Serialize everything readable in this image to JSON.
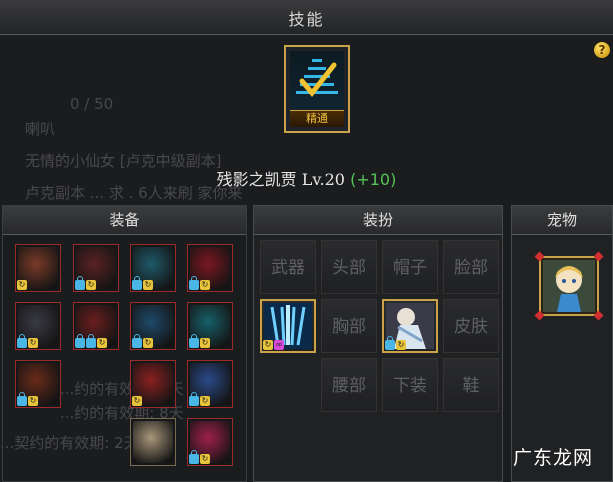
{
  "window": {
    "title": "技能"
  },
  "help": {
    "label": "?"
  },
  "background_chat": {
    "line_counter": "0 / 50",
    "channel": "喇叭",
    "lines": [
      "无情的小仙女  [卢克中级副本]",
      "卢克副本 ... 求 . 6人来刷 家你来",
      "...约的有效期: 8天",
      "...约的有效期: 8天",
      "...契约的有效期: 2天"
    ]
  },
  "skill": {
    "badge": "精通",
    "name": "残影之凯贾",
    "level": "Lv.20",
    "bonus": "(+10)"
  },
  "equipment": {
    "title": "装备",
    "slots": [
      {
        "icon": "horned-helmet-icon",
        "color": "#7a3a28",
        "locks": 0,
        "cycle": true
      },
      {
        "icon": "dark-armor-icon",
        "color": "#5a2222",
        "locks": 1,
        "cycle": true
      },
      {
        "icon": "teal-shoulder-icon",
        "color": "#1e5a6a",
        "locks": 1,
        "cycle": true
      },
      {
        "icon": "red-cape-icon",
        "color": "#7a1620",
        "locks": 1,
        "cycle": true
      },
      {
        "icon": "dark-gauntlet-icon",
        "color": "#3a3a44",
        "locks": 1,
        "cycle": true
      },
      {
        "icon": "crimson-plate-icon",
        "color": "#6a1e1e",
        "locks": 2,
        "cycle": true
      },
      {
        "icon": "blue-guard-icon",
        "color": "#1e4a6a",
        "locks": 1,
        "cycle": true
      },
      {
        "icon": "cyan-helm-icon",
        "color": "#17606a",
        "locks": 1,
        "cycle": true
      },
      {
        "icon": "red-boots-icon",
        "color": "#6a2a1a",
        "locks": 1,
        "cycle": true
      },
      {
        "icon": "flame-ring-icon",
        "color": "#8a2020",
        "locks": 0,
        "cycle": true
      },
      {
        "icon": "blue-amulet-icon",
        "color": "#2a4a8a",
        "locks": 1,
        "cycle": true
      },
      {
        "icon": "beige-stone-icon",
        "color": "#a8967a",
        "locks": 0,
        "cycle": false
      },
      {
        "icon": "pink-crystal-icon",
        "color": "#a0204a",
        "locks": 1,
        "cycle": true
      }
    ]
  },
  "dress": {
    "title": "装扮",
    "slots": [
      "武器",
      "头部",
      "帽子",
      "脸部",
      "胸部",
      "皮肤",
      "腰部",
      "下装",
      "鞋"
    ]
  },
  "pet": {
    "title": "宠物"
  },
  "watermark": "广东龙网"
}
